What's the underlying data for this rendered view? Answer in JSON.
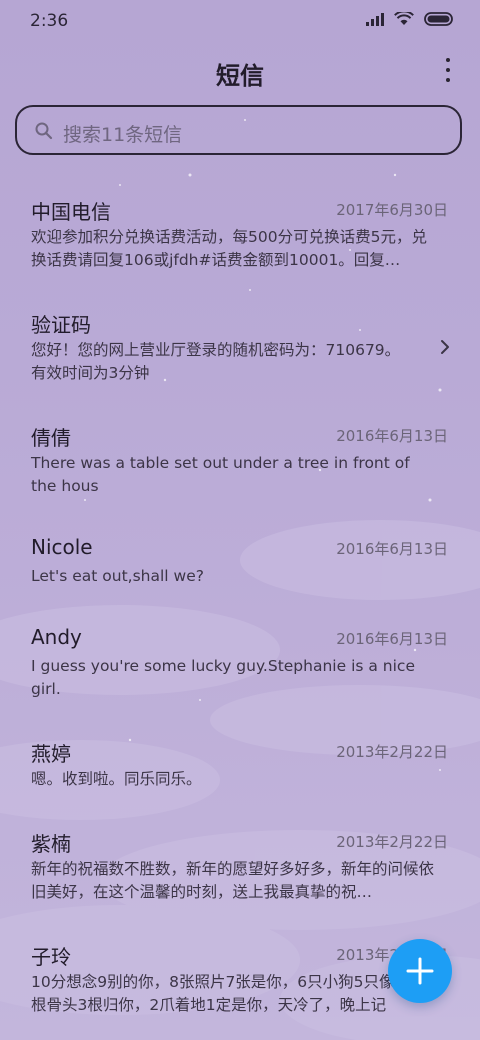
{
  "status_bar": {
    "time": "2:36"
  },
  "header": {
    "title": "短信"
  },
  "search": {
    "placeholder": "搜索11条短信"
  },
  "messages": [
    {
      "sender": "中国电信",
      "date": "2017年6月30日",
      "preview": "欢迎参加积分兑换话费活动，每500分可兑换话费5元，兑换话费请回复106或jfdh#话费金额到10001。回复…"
    },
    {
      "sender": "验证码",
      "date": "",
      "preview": "您好！您的网上营业厅登录的随机密码为：710679。有效时间为3分钟"
    },
    {
      "sender": "倩倩",
      "date": "2016年6月13日",
      "preview": "There was a table set out under a tree in front of the hous"
    },
    {
      "sender": "Nicole",
      "date": "2016年6月13日",
      "preview": "Let's eat out,shall we?"
    },
    {
      "sender": "Andy",
      "date": "2016年6月13日",
      "preview": "I guess you're some lucky guy.Stephanie is a nice girl."
    },
    {
      "sender": "燕婷",
      "date": "2013年2月22日",
      "preview": "嗯。收到啦。同乐同乐。"
    },
    {
      "sender": "紫楠",
      "date": "2013年2月22日",
      "preview": "新年的祝福数不胜数，新年的愿望好多好多，新年的问候依旧美好，在这个温馨的时刻，送上我最真挚的祝…"
    },
    {
      "sender": "子玲",
      "date": "2013年2月22日",
      "preview": "10分想念9别的你，8张照片7张是你，6只小狗5只像你，4根骨头3根归你，2爪着地1定是你，天冷了，晚上记"
    }
  ],
  "icons": {
    "signal": "signal-icon",
    "wifi": "wifi-icon",
    "battery": "battery-icon",
    "more": "more-vertical-icon",
    "search": "search-icon",
    "chevron": "chevron-right-icon",
    "moon": "moon-icon",
    "compose": "plus-icon"
  },
  "colors": {
    "fab": "#1d9ef5",
    "background": "#b9aad6"
  }
}
